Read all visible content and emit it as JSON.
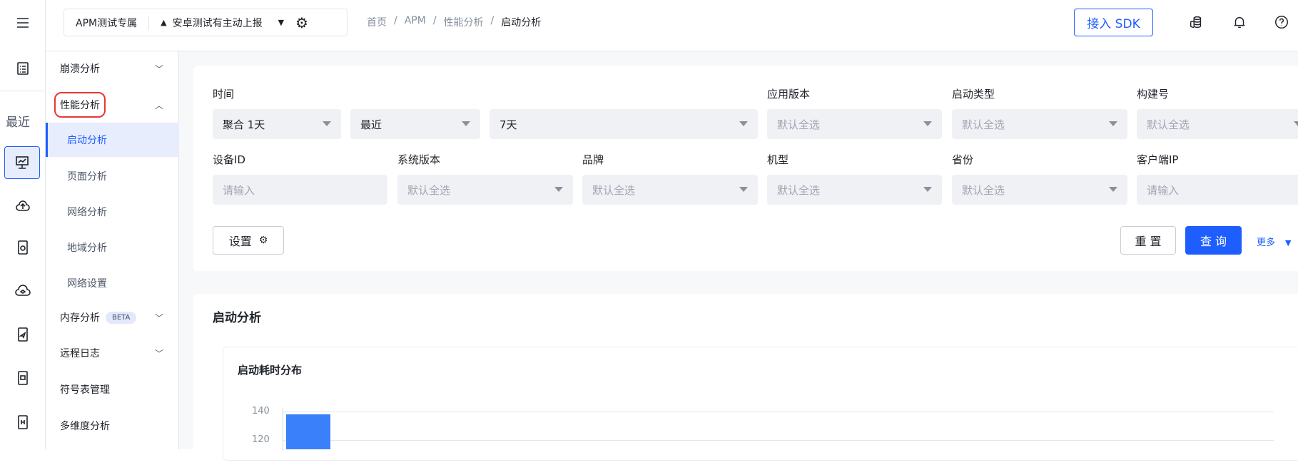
{
  "header": {
    "project": "APM测试专属",
    "app": "安卓测试有主动上报",
    "breadcrumb": [
      "首页",
      "APM",
      "性能分析",
      "启动分析"
    ],
    "sdk_button": "接入 SDK"
  },
  "rail": {
    "recent": "最近"
  },
  "sidebar": {
    "items": [
      {
        "label": "崩溃分析"
      },
      {
        "label": "性能分析"
      },
      {
        "label": "启动分析"
      },
      {
        "label": "页面分析"
      },
      {
        "label": "网络分析"
      },
      {
        "label": "地域分析"
      },
      {
        "label": "网络设置"
      },
      {
        "label": "内存分析",
        "badge": "BETA"
      },
      {
        "label": "远程日志"
      },
      {
        "label": "符号表管理"
      },
      {
        "label": "多维度分析"
      }
    ]
  },
  "filters": {
    "time_label": "时间",
    "time_agg": "聚合 1天",
    "time_mode": "最近",
    "time_range": "7天",
    "fields": [
      {
        "label": "应用版本",
        "value": "默认全选"
      },
      {
        "label": "启动类型",
        "value": "默认全选"
      },
      {
        "label": "构建号",
        "value": "默认全选"
      },
      {
        "label": "设备ID",
        "value": "请输入"
      },
      {
        "label": "系统版本",
        "value": "默认全选"
      },
      {
        "label": "品牌",
        "value": "默认全选"
      },
      {
        "label": "机型",
        "value": "默认全选"
      },
      {
        "label": "省份",
        "value": "默认全选"
      },
      {
        "label": "客户端IP",
        "value": "请输入"
      }
    ],
    "settings": "设置",
    "reset": "重 置",
    "query": "查 询",
    "more": "更多"
  },
  "section": {
    "title": "启动分析",
    "chart_title": "启动耗时分布"
  },
  "chart_data": {
    "type": "bar",
    "title": "启动耗时分布",
    "yticks": [
      "140",
      "120"
    ],
    "values": [
      138
    ],
    "ylim": [
      120,
      140
    ]
  },
  "colors": {
    "accent": "#1e5eff",
    "bar": "#3a80fa",
    "highlight": "#e53935"
  }
}
